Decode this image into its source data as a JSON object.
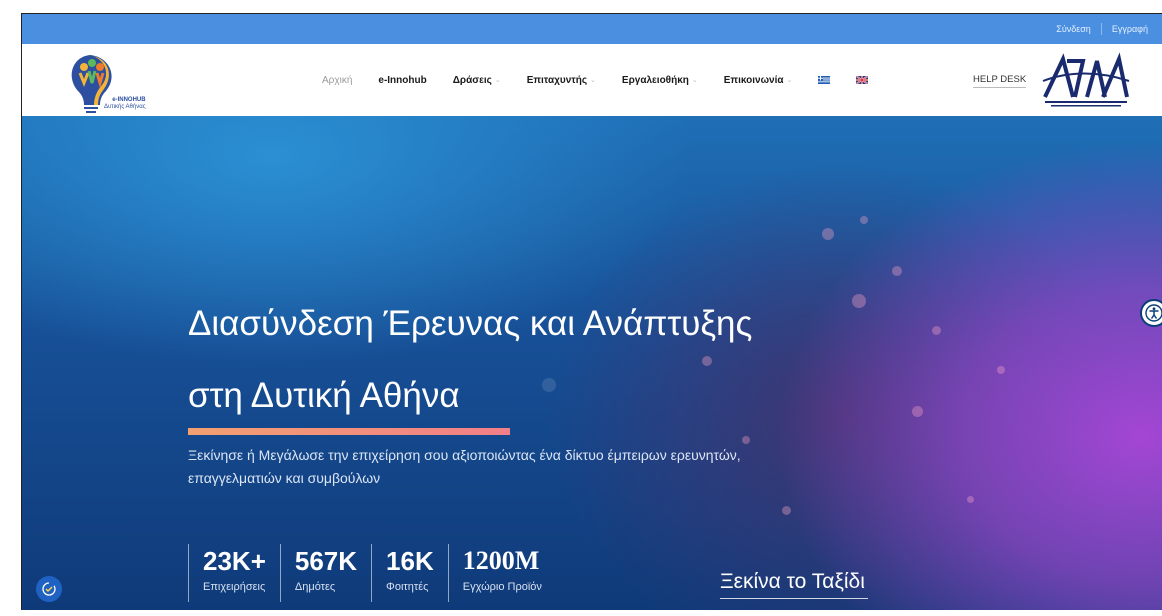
{
  "topbar": {
    "login": "Σύνδεση",
    "register": "Εγγραφή"
  },
  "brand": {
    "line1": "e-INNOHUB",
    "line2": "Δυτικής Αθήνας"
  },
  "menu": {
    "items": [
      {
        "label": "Αρχική"
      },
      {
        "label": "e-Innohub"
      },
      {
        "label": "Δράσεις"
      },
      {
        "label": "Επιταχυντής"
      },
      {
        "label": "Εργαλειοθήκη"
      },
      {
        "label": "Επικοινωνία"
      }
    ],
    "helpdesk": "HELP DESK"
  },
  "hero": {
    "title_line1": "Διασύνδεση Έρευνας και Ανάπτυξης",
    "title_line2": "στη Δυτική Αθήνα",
    "subtitle": "Ξεκίνησε ή Μεγάλωσε την επιχείρηση σου αξιοποιώντας ένα δίκτυο έμπειρων ερευνητών, επαγγελματιών και συμβούλων",
    "stats": [
      {
        "value": "23K+",
        "label": "Επιχειρήσεις"
      },
      {
        "value": "567K",
        "label": "Δημότες"
      },
      {
        "value": "16K",
        "label": "Φοιτητές"
      },
      {
        "value": "1200M",
        "label": "Εγχώριο Προϊόν"
      }
    ],
    "cta": "Ξεκίνα το Ταξίδι"
  },
  "colors": {
    "topbar": "#4a8fe0",
    "accent_bar": "#f2a071",
    "hero_blue": "#1f6fb6",
    "hero_purple": "#a446d4"
  }
}
